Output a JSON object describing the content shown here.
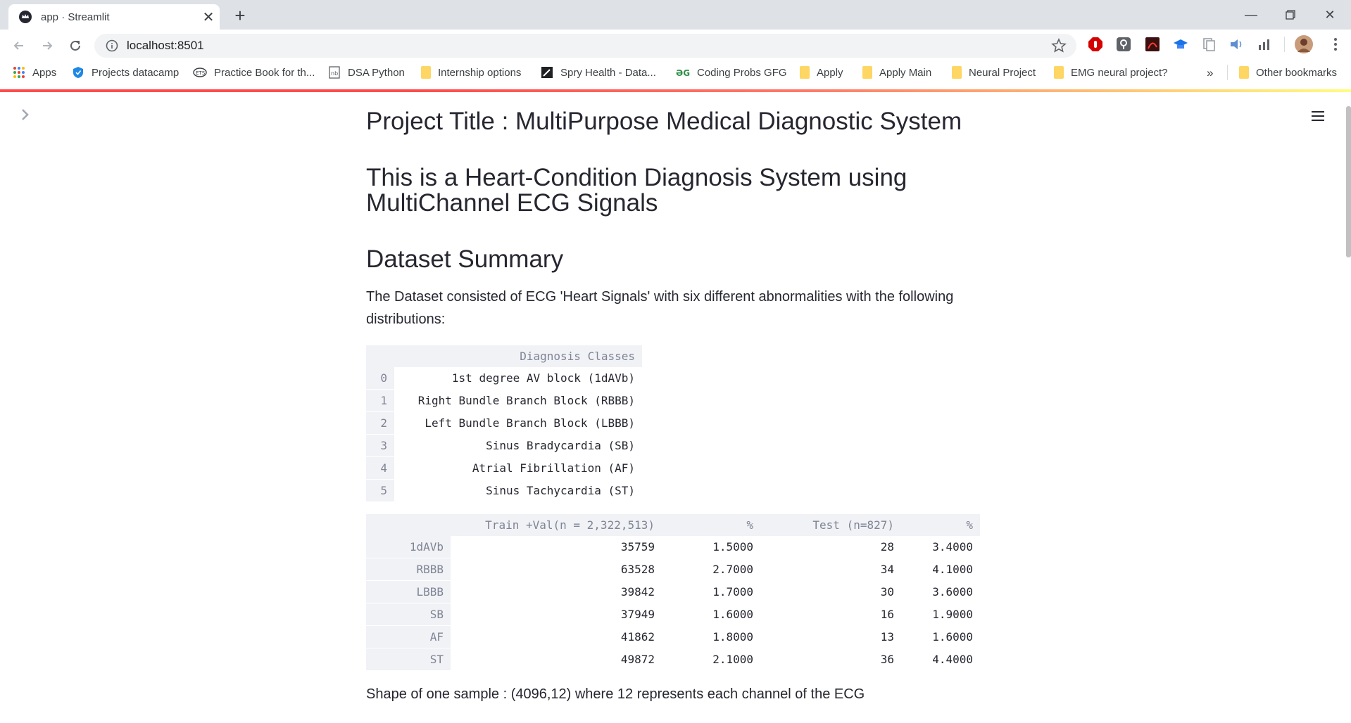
{
  "browser": {
    "tab_title": "app · Streamlit",
    "url": "localhost:8501",
    "bookmarks": [
      {
        "label": "Apps",
        "icon": "apps-grid-icon"
      },
      {
        "label": "Projects datacamp",
        "icon": "shield-icon"
      },
      {
        "label": "Practice Book for th...",
        "icon": "ets-icon"
      },
      {
        "label": "DSA Python",
        "icon": "notebook-icon"
      },
      {
        "label": "Internship options",
        "icon": "folder-icon"
      },
      {
        "label": "Spry Health - Data...",
        "icon": "pen-icon"
      },
      {
        "label": "Coding Probs GFG",
        "icon": "gfg-icon"
      },
      {
        "label": "Apply",
        "icon": "folder-icon"
      },
      {
        "label": "Apply Main",
        "icon": "folder-icon"
      },
      {
        "label": "Neural Project",
        "icon": "folder-icon"
      },
      {
        "label": "EMG neural project?",
        "icon": "folder-icon"
      }
    ],
    "overflow": "»",
    "other_bookmarks": "Other bookmarks"
  },
  "app": {
    "title": "Project Title : MultiPurpose Medical Diagnostic System",
    "subtitle": "This is a Heart-Condition Diagnosis System using MultiChannel ECG Signals",
    "section": "Dataset Summary",
    "description": "The Dataset consisted of ECG 'Heart Signals' with six different abnormalities with the following distributions:",
    "table1": {
      "header": "Diagnosis Classes",
      "rows": [
        {
          "idx": "0",
          "value": "1st degree AV block (1dAVb)"
        },
        {
          "idx": "1",
          "value": "Right Bundle Branch Block (RBBB)"
        },
        {
          "idx": "2",
          "value": "Left Bundle Branch Block (LBBB)"
        },
        {
          "idx": "3",
          "value": "Sinus Bradycardia (SB)"
        },
        {
          "idx": "4",
          "value": "Atrial Fibrillation (AF)"
        },
        {
          "idx": "5",
          "value": "Sinus Tachycardia (ST)"
        }
      ]
    },
    "table2": {
      "headers": [
        "Train +Val(n = 2,322,513)",
        "%",
        "Test (n=827)",
        "%"
      ],
      "rows": [
        {
          "idx": "1dAVb",
          "train": "35759",
          "train_pct": "1.5000",
          "test": "28",
          "test_pct": "3.4000"
        },
        {
          "idx": "RBBB",
          "train": "63528",
          "train_pct": "2.7000",
          "test": "34",
          "test_pct": "4.1000"
        },
        {
          "idx": "LBBB",
          "train": "39842",
          "train_pct": "1.7000",
          "test": "30",
          "test_pct": "3.6000"
        },
        {
          "idx": "SB",
          "train": "37949",
          "train_pct": "1.6000",
          "test": "16",
          "test_pct": "1.9000"
        },
        {
          "idx": "AF",
          "train": "41862",
          "train_pct": "1.8000",
          "test": "13",
          "test_pct": "1.6000"
        },
        {
          "idx": "ST",
          "train": "49872",
          "train_pct": "2.1000",
          "test": "36",
          "test_pct": "4.4000"
        }
      ]
    },
    "footer": "Shape of one sample : (4096,12) where 12 represents each channel of the ECG"
  }
}
